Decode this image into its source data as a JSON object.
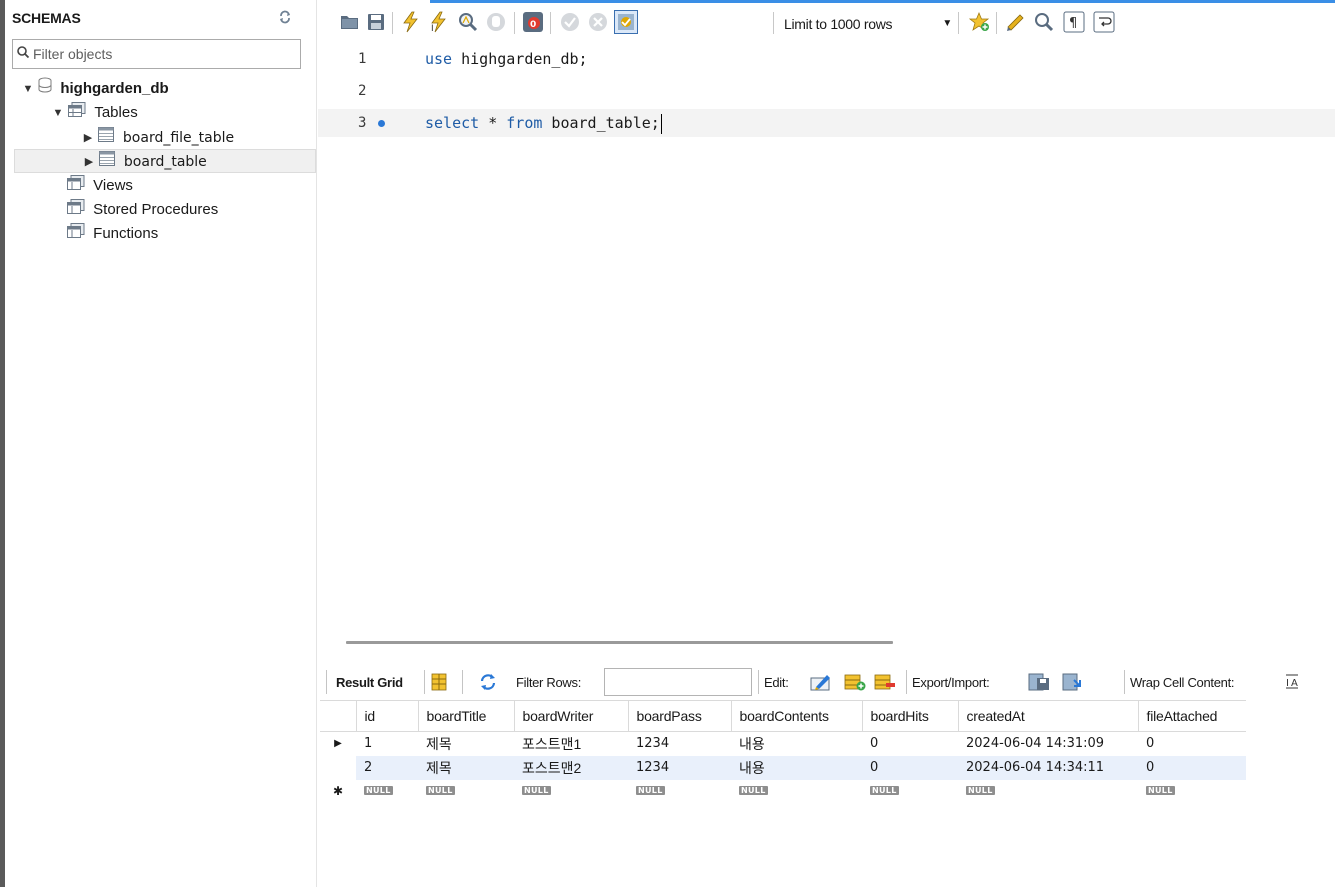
{
  "sidebar": {
    "header": "SCHEMAS",
    "filter_placeholder": "Filter objects",
    "database": "highgarden_db",
    "tables_label": "Tables",
    "tables": [
      "board_file_table",
      "board_table"
    ],
    "views_label": "Views",
    "stored_procedures_label": "Stored Procedures",
    "functions_label": "Functions"
  },
  "toolbar": {
    "limit_label": "Limit to 1000 rows",
    "icons": [
      "open-folder-icon",
      "save-icon",
      "execute-lightning-icon",
      "execute-cursor-lightning-icon",
      "explain-magnifier-icon",
      "stop-icon",
      "toggle-error-icon",
      "commit-icon",
      "rollback-icon",
      "autocommit-icon",
      "beautify-star-icon",
      "beautify-brush-icon",
      "find-icon",
      "invisible-chars-icon",
      "wrap-icon"
    ]
  },
  "editor": {
    "lines": [
      {
        "number": "1",
        "text": "use highgarden_db;"
      },
      {
        "number": "2",
        "text": ""
      },
      {
        "number": "3",
        "text": "select * from board_table;"
      }
    ]
  },
  "result_toolbar": {
    "result_grid_label": "Result Grid",
    "filter_rows_label": "Filter Rows:",
    "filter_rows_value": "",
    "edit_label": "Edit:",
    "export_import_label": "Export/Import:",
    "wrap_cell_label": "Wrap Cell Content:"
  },
  "grid": {
    "columns": [
      "id",
      "boardTitle",
      "boardWriter",
      "boardPass",
      "boardContents",
      "boardHits",
      "createdAt",
      "fileAttached"
    ],
    "rows": [
      [
        "1",
        "제목",
        "포스트맨1",
        "1234",
        "내용",
        "0",
        "2024-06-04 14:31:09",
        "0"
      ],
      [
        "2",
        "제목",
        "포스트맨2",
        "1234",
        "내용",
        "0",
        "2024-06-04 14:34:11",
        "0"
      ]
    ],
    "null_label": "NULL"
  },
  "colors": {
    "keyword": "#1f5ca6",
    "accent": "#3a8ee6",
    "alt_row": "#e9f0fb"
  }
}
